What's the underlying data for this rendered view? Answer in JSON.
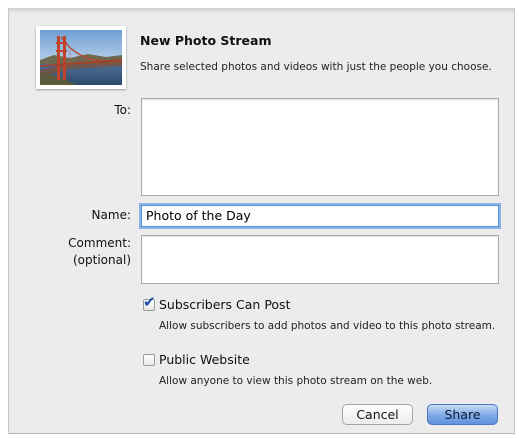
{
  "dialog": {
    "title": "New Photo Stream",
    "subtitle": "Share selected photos and videos with just the people you choose."
  },
  "form": {
    "to_label": "To:",
    "to_value": "",
    "name_label": "Name:",
    "name_value": "Photo of the Day",
    "comment_label_line1": "Comment:",
    "comment_label_line2": "(optional)",
    "comment_value": ""
  },
  "options": {
    "subscribers_can_post": {
      "label": "Subscribers Can Post",
      "description": "Allow subscribers to add photos and video to this photo stream.",
      "checked": true
    },
    "public_website": {
      "label": "Public Website",
      "description": "Allow anyone to view this photo stream on the web.",
      "checked": false
    }
  },
  "buttons": {
    "cancel_label": "Cancel",
    "share_label": "Share"
  },
  "icons": {
    "thumbnail": "golden-gate-bridge-photo",
    "checkmark": "checkmark-icon"
  },
  "colors": {
    "sheet_background": "#ececec",
    "focus_ring": "#8eb4ea",
    "default_button": "#7fa9e6"
  }
}
